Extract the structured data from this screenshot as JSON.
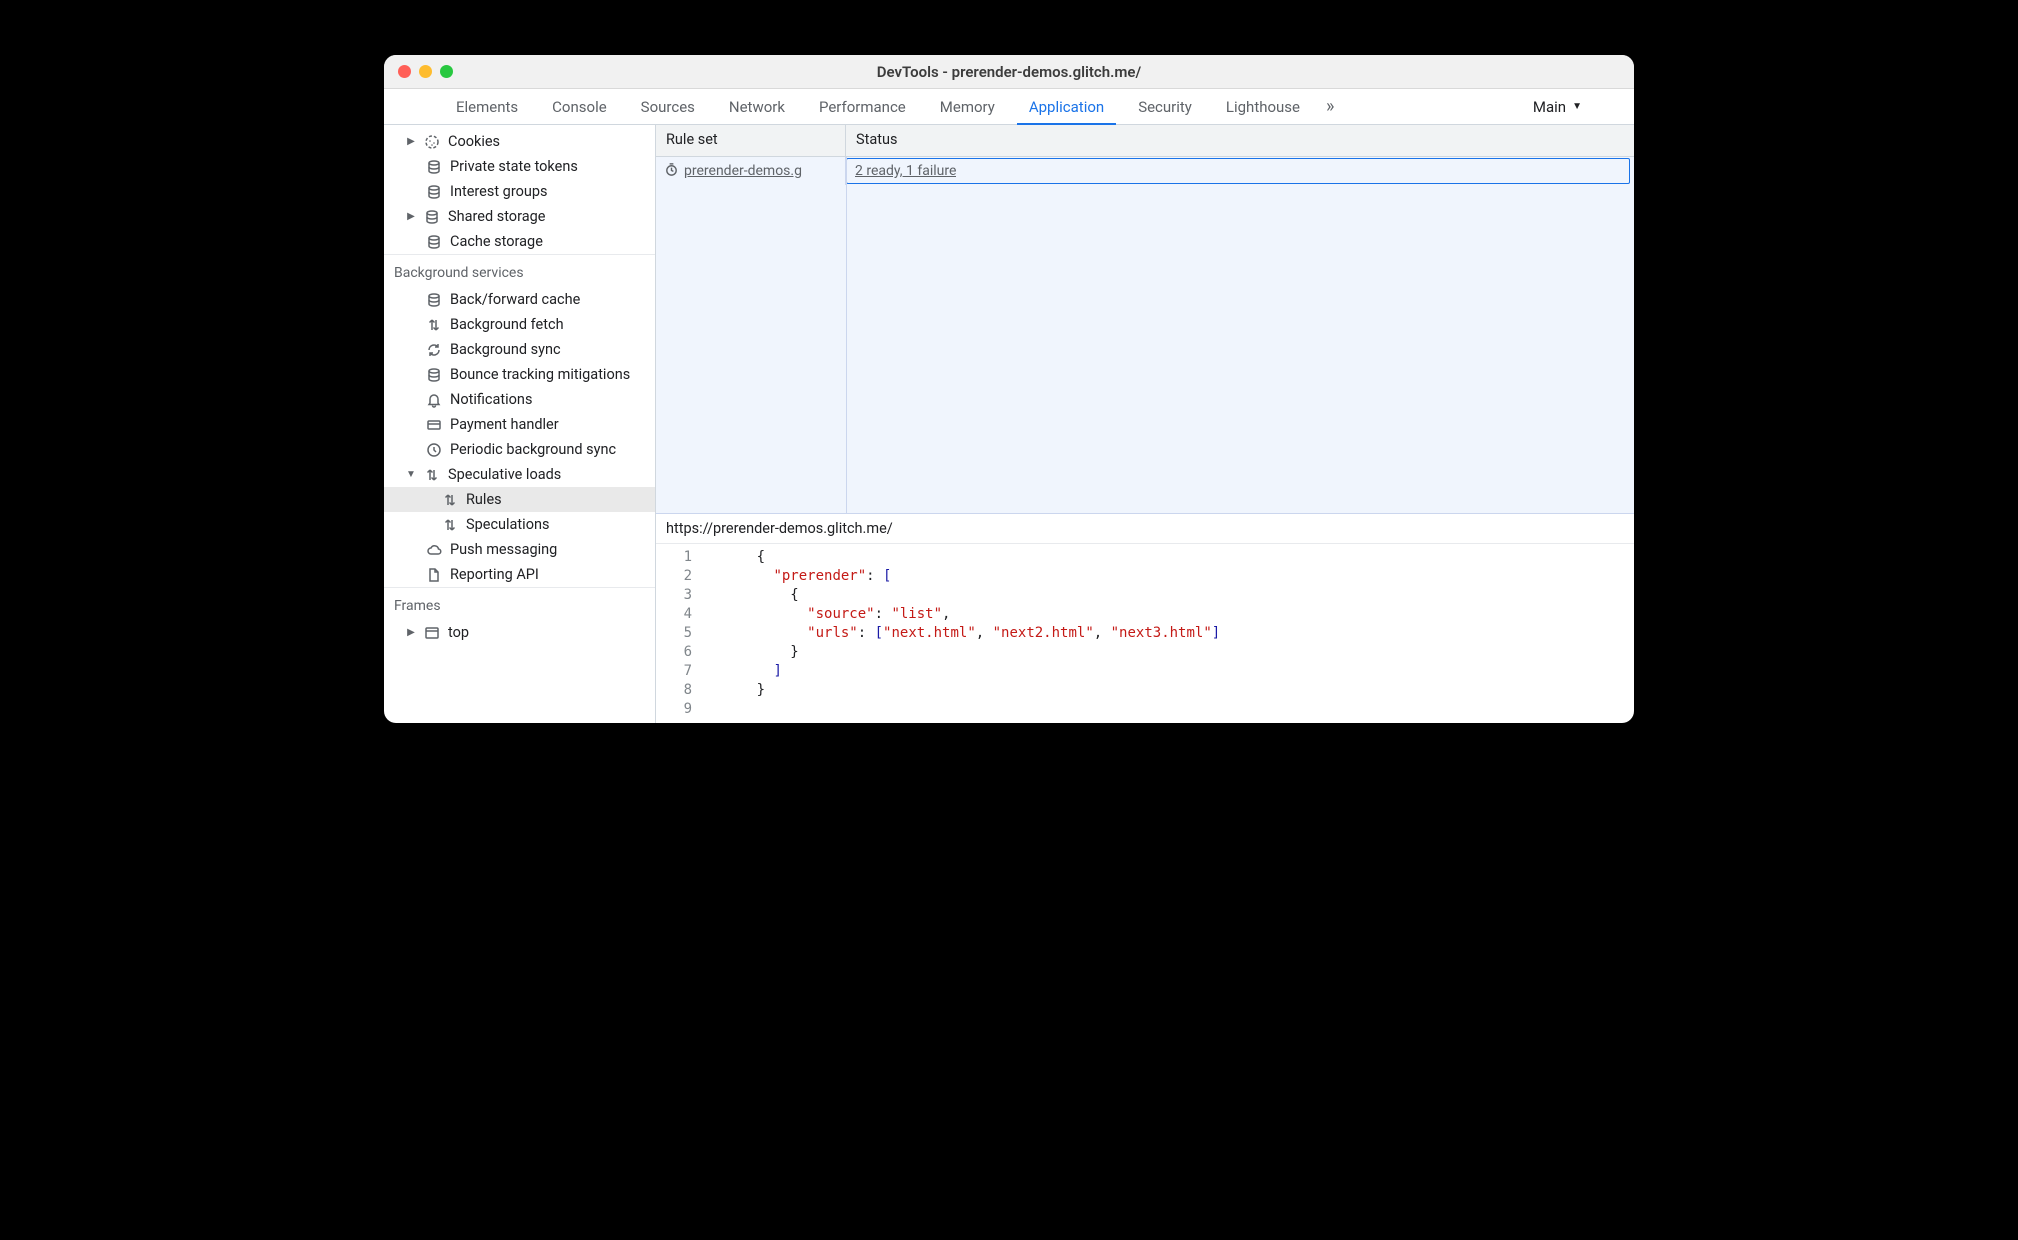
{
  "window_title": "DevTools - prerender-demos.glitch.me/",
  "tabs": {
    "elements": "Elements",
    "console": "Console",
    "sources": "Sources",
    "network": "Network",
    "performance": "Performance",
    "memory": "Memory",
    "application": "Application",
    "security": "Security",
    "lighthouse": "Lighthouse"
  },
  "target_name": "Main",
  "sidebar": {
    "cookies": "Cookies",
    "private_state_tokens": "Private state tokens",
    "interest_groups": "Interest groups",
    "shared_storage": "Shared storage",
    "cache_storage": "Cache storage",
    "background_services_header": "Background services",
    "back_forward_cache": "Back/forward cache",
    "background_fetch": "Background fetch",
    "background_sync": "Background sync",
    "bounce_tracking": "Bounce tracking mitigations",
    "notifications": "Notifications",
    "payment_handler": "Payment handler",
    "periodic_bg_sync": "Periodic background sync",
    "speculative_loads": "Speculative loads",
    "rules": "Rules",
    "speculations": "Speculations",
    "push_messaging": "Push messaging",
    "reporting_api": "Reporting API",
    "frames_header": "Frames",
    "top_frame": "top"
  },
  "grid": {
    "col_rule": "Rule set",
    "col_status": "Status",
    "row_rule_link": "prerender-demos.g",
    "row_status_link": "2 ready, 1 failure"
  },
  "detail": {
    "url": "https://prerender-demos.glitch.me/",
    "code": {
      "lines": [
        "1",
        "2",
        "3",
        "4",
        "5",
        "6",
        "7",
        "8",
        "9"
      ],
      "keys": {
        "prerender": "\"prerender\"",
        "source": "\"source\"",
        "urls": "\"urls\""
      },
      "vals": {
        "list": "\"list\"",
        "u1": "\"next.html\"",
        "u2": "\"next2.html\"",
        "u3": "\"next3.html\""
      }
    }
  }
}
